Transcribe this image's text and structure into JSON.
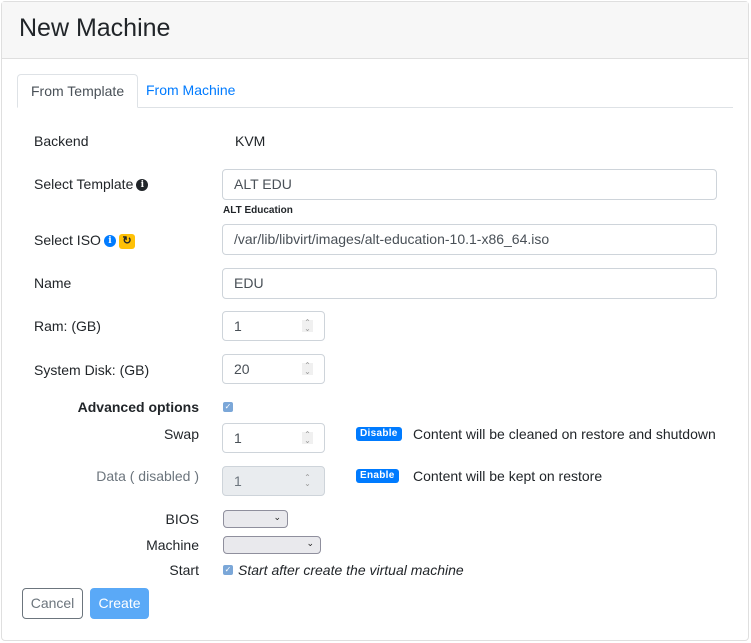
{
  "header": {
    "title": "New Machine"
  },
  "tabs": [
    {
      "label": "From Template",
      "active": true
    },
    {
      "label": "From Machine",
      "active": false
    }
  ],
  "form": {
    "backend": {
      "label": "Backend",
      "value": "KVM"
    },
    "template": {
      "label": "Select Template",
      "value": "ALT EDU",
      "help": "ALT Education",
      "icon": "info-circle-icon"
    },
    "iso": {
      "label": "Select ISO",
      "value": "/var/lib/libvirt/images/alt-education-10.1-x86_64.iso",
      "icons": [
        "info-circle-icon",
        "refresh-icon"
      ]
    },
    "name": {
      "label": "Name",
      "value": "EDU"
    },
    "ram": {
      "label": "Ram: (GB)",
      "value": "1"
    },
    "disk": {
      "label": "System Disk: (GB)",
      "value": "20"
    },
    "advanced": {
      "label": "Advanced options",
      "checked": true
    },
    "swap": {
      "label": "Swap",
      "value": "1",
      "badge": "Disable",
      "note": "Content will be cleaned on restore and shutdown"
    },
    "data": {
      "label": "Data ( disabled )",
      "value": "1",
      "badge": "Enable",
      "note": "Content will be kept on restore",
      "disabled": true
    },
    "bios": {
      "label": "BIOS",
      "value": ""
    },
    "machine": {
      "label": "Machine",
      "value": ""
    },
    "start": {
      "label": "Start",
      "checkbox_label": "Start after create the virtual machine",
      "checked": true
    }
  },
  "buttons": {
    "cancel": "Cancel",
    "create": "Create"
  },
  "colors": {
    "primary": "#007bff",
    "warning": "#ffc107",
    "create_disabled": "#5aa9f7"
  }
}
